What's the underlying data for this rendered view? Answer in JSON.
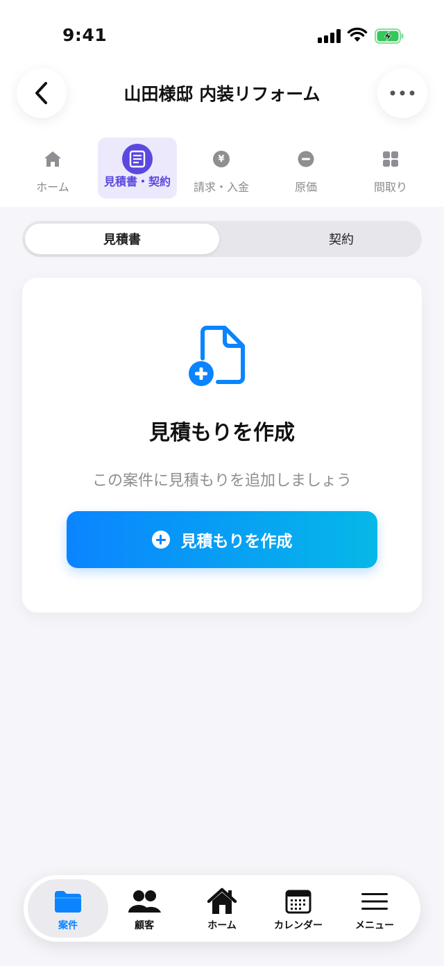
{
  "status_bar": {
    "time": "9:41"
  },
  "header": {
    "title": "山田様邸 内装リフォーム"
  },
  "section_tabs": [
    {
      "label": "ホーム",
      "icon": "house-icon"
    },
    {
      "label": "見積書・契約",
      "icon": "document-list-icon",
      "active": true
    },
    {
      "label": "請求・入金",
      "icon": "yen-icon",
      "glyph": "¥"
    },
    {
      "label": "原価",
      "icon": "minus-circle-icon"
    },
    {
      "label": "間取り",
      "icon": "grid-icon"
    }
  ],
  "segmented": {
    "options": [
      "見積書",
      "契約"
    ],
    "selected": "見積書"
  },
  "empty_state": {
    "icon": "document-plus-icon",
    "title": "見積もりを作成",
    "subtitle": "この案件に見積もりを追加しましょう",
    "button_label": "見積もりを作成"
  },
  "bottom_nav": [
    {
      "label": "案件",
      "icon": "folder-icon",
      "active": true
    },
    {
      "label": "顧客",
      "icon": "people-icon"
    },
    {
      "label": "ホーム",
      "icon": "house-icon"
    },
    {
      "label": "カレンダー",
      "icon": "calendar-icon"
    },
    {
      "label": "メニュー",
      "icon": "menu-icon"
    }
  ],
  "colors": {
    "accent_purple": "#5a48e0",
    "accent_blue": "#0a84ff",
    "gradient_end": "#06b8e8",
    "battery_green": "#34c759"
  }
}
